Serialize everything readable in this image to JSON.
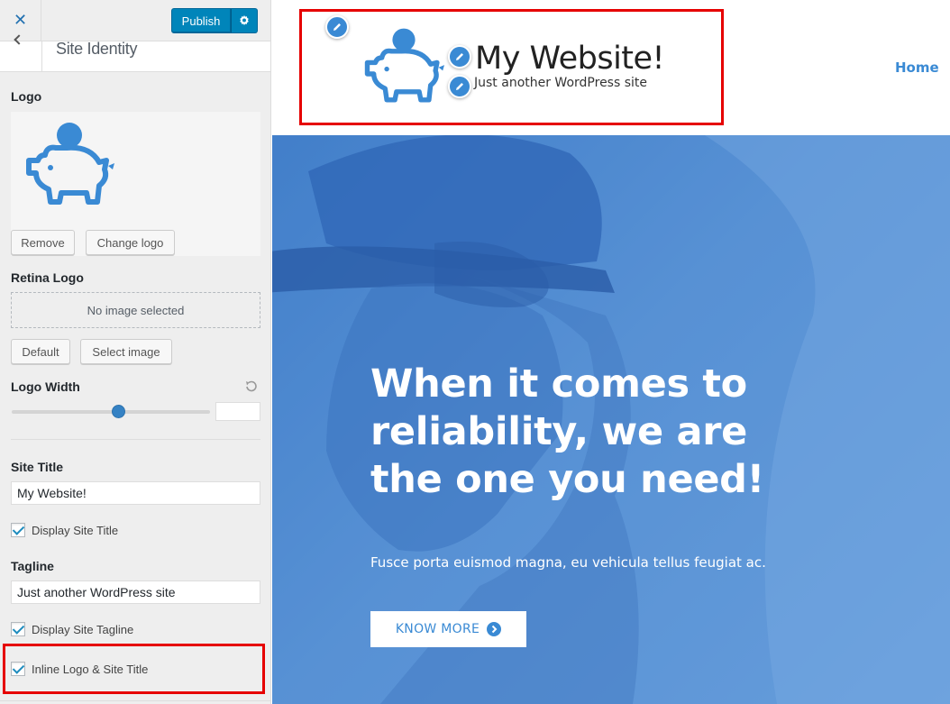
{
  "topbar": {
    "close_symbol": "✕",
    "publish_label": "Publish",
    "settings_icon": "gear-icon"
  },
  "section": {
    "title": "Site Identity",
    "back_icon": "chevron-left-icon"
  },
  "logo": {
    "label": "Logo",
    "image_icon": "piggy-bank-icon",
    "remove_label": "Remove",
    "change_label": "Change logo"
  },
  "retina": {
    "label": "Retina Logo",
    "placeholder": "No image selected",
    "default_label": "Default",
    "select_label": "Select image"
  },
  "logo_width": {
    "label": "Logo Width",
    "slider_fraction": 0.5,
    "value": ""
  },
  "site_title": {
    "label": "Site Title",
    "value": "My Website!",
    "display_label": "Display Site Title",
    "display_checked": true
  },
  "tagline": {
    "label": "Tagline",
    "value": "Just another WordPress site",
    "display_label": "Display Site Tagline",
    "display_checked": true
  },
  "inline": {
    "label": "Inline Logo & Site Title",
    "checked": true
  },
  "preview": {
    "site_title": "My Website!",
    "tagline": "Just another WordPress site",
    "nav_home": "Home",
    "hero_heading": "When it comes to reliability, we are the one you need!",
    "hero_text": "Fusce porta euismod magna, eu vehicula tellus feugiat ac.",
    "hero_button": "KNOW MORE"
  },
  "colors": {
    "accent": "#3a8ad4",
    "publish": "#0085ba",
    "highlight": "#e60000"
  }
}
